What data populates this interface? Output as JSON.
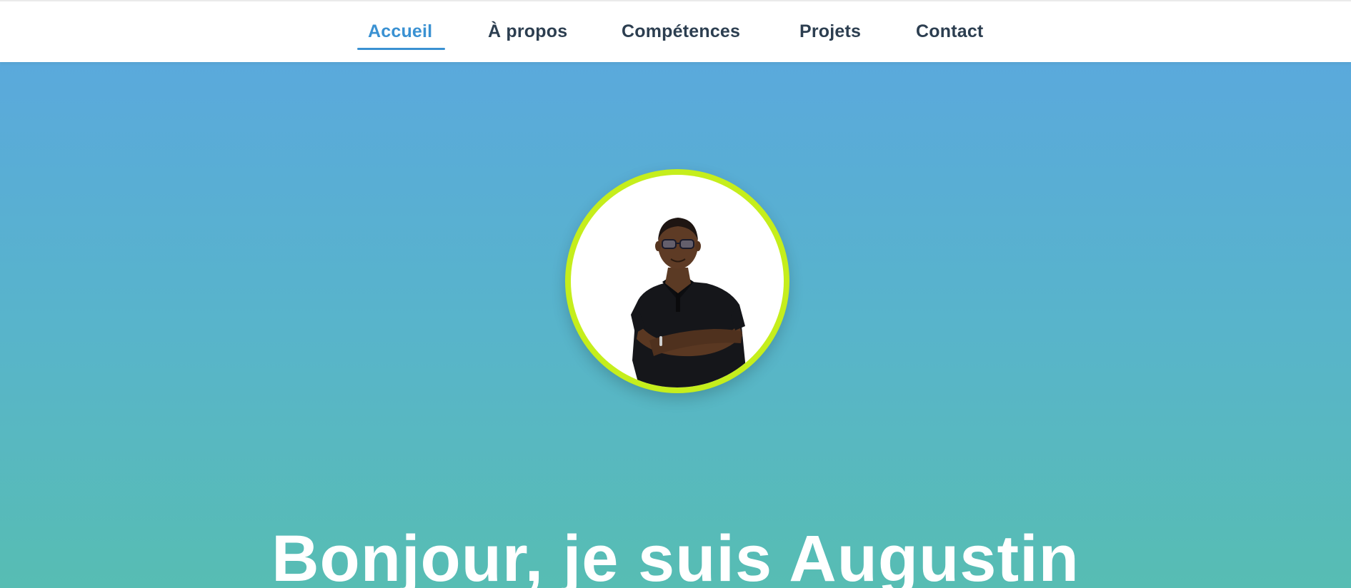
{
  "nav": {
    "items": [
      {
        "label": "Accueil",
        "active": true
      },
      {
        "label": "À propos",
        "active": false
      },
      {
        "label": "Compétences",
        "active": false
      },
      {
        "label": "Projets",
        "active": false
      },
      {
        "label": "Contact",
        "active": false
      }
    ]
  },
  "hero": {
    "title": "Bonjour, je suis Augustin"
  },
  "colors": {
    "accent": "#3a91d2",
    "nav_text": "#2c3e50",
    "ring": "#c5ee1c",
    "gradient_top": "#5aa9dc",
    "gradient_bottom": "#57bdb3"
  }
}
